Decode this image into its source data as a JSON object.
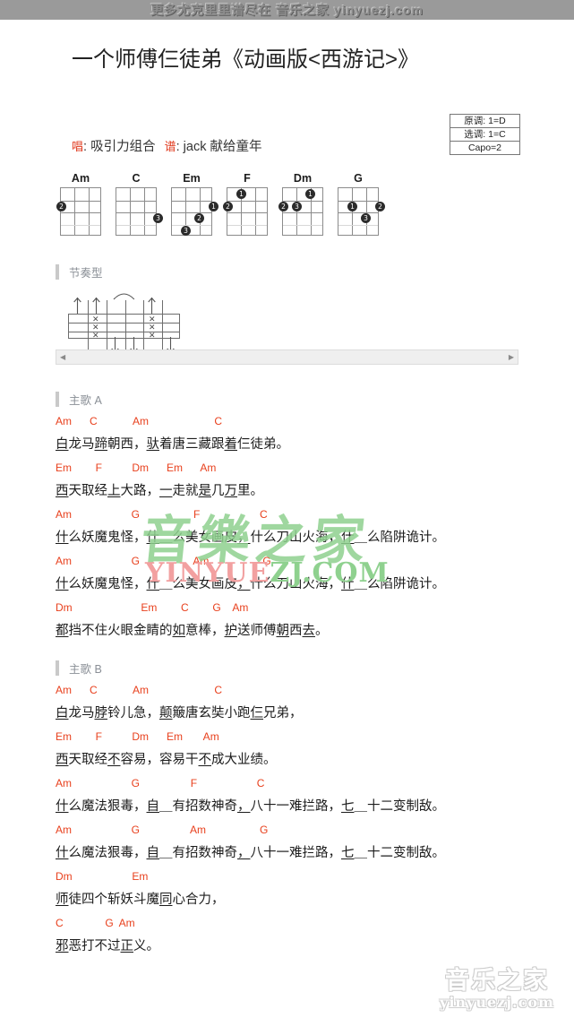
{
  "banner": {
    "text": "更多尤克里里谱尽在 音乐之家 yinyuezj.com"
  },
  "header": {
    "title": "一个师傅仨徒弟《动画版<西游记>》",
    "singer_label": "唱",
    "singer": "吸引力组合",
    "arranger_label": "谱",
    "arranger": "jack 献给童年"
  },
  "key_box": {
    "original_key": "原调: 1=D",
    "selected_key": "选调: 1=C",
    "capo": "Capo=2"
  },
  "chords": [
    {
      "name": "Am",
      "dots": [
        {
          "string": 1,
          "fret": 2,
          "finger": "2"
        }
      ]
    },
    {
      "name": "C",
      "dots": [
        {
          "string": 4,
          "fret": 3,
          "finger": "3"
        }
      ]
    },
    {
      "name": "Em",
      "dots": [
        {
          "string": 4,
          "fret": 2,
          "finger": "1"
        },
        {
          "string": 3,
          "fret": 3,
          "finger": "2"
        },
        {
          "string": 2,
          "fret": 4,
          "finger": "3"
        }
      ]
    },
    {
      "name": "F",
      "dots": [
        {
          "string": 2,
          "fret": 1,
          "finger": "1"
        },
        {
          "string": 1,
          "fret": 2,
          "finger": "2"
        }
      ]
    },
    {
      "name": "Dm",
      "dots": [
        {
          "string": 3,
          "fret": 1,
          "finger": "1"
        },
        {
          "string": 1,
          "fret": 2,
          "finger": "2"
        },
        {
          "string": 2,
          "fret": 2,
          "finger": "3"
        }
      ]
    },
    {
      "name": "G",
      "dots": [
        {
          "string": 2,
          "fret": 2,
          "finger": "1"
        },
        {
          "string": 4,
          "fret": 2,
          "finger": "2"
        },
        {
          "string": 3,
          "fret": 3,
          "finger": "3"
        }
      ]
    }
  ],
  "rhythm": {
    "title": "节奏型",
    "up_arrows": [
      1,
      2,
      5
    ],
    "down_arrows": [
      3,
      4,
      6
    ],
    "muted_columns": [
      2,
      5
    ],
    "tie_over": [
      3,
      4
    ],
    "brackets": [
      [
        2,
        3
      ],
      [
        5,
        6
      ]
    ]
  },
  "scrollbar": {
    "left_arrow": "◀",
    "right_arrow": "▶"
  },
  "sections": [
    {
      "title": "主歌 A",
      "lines": [
        {
          "chords": "Am      C            Am                      C",
          "lyric": "白龙马蹄朝西，驮着唐三藏跟着仨徒弟。"
        },
        {
          "chords": "Em        F          Dm      Em      Am",
          "lyric": "西天取经上大路，一走就是几万里。"
        },
        {
          "chords": "Am                    G                  F                    C",
          "lyric": "什么妖魔鬼怪，什＿么美女画皮，什么刀山火海，什＿么陷阱诡计。"
        },
        {
          "chords": "Am                    G                  Am                  G",
          "lyric": "什么妖魔鬼怪，什＿么美女画皮，什么刀山火海，什＿么陷阱诡计。"
        },
        {
          "chords": "Dm                       Em        C        G    Am",
          "lyric": "都挡不住火眼金睛的如意棒，护送师傅朝西去。"
        }
      ]
    },
    {
      "title": "主歌 B",
      "lines": [
        {
          "chords": "Am      C            Am                      C",
          "lyric": "白龙马脖铃儿急，颠簸唐玄奘小跑仨兄弟，"
        },
        {
          "chords": "Em        F          Dm      Em       Am",
          "lyric": "西天取经不容易，容易干不成大业绩。"
        },
        {
          "chords": "Am                    G                 F                    C",
          "lyric": "什么魔法狠毒，自＿有招数神奇，八十一难拦路，七＿十二变制敌。"
        },
        {
          "chords": "Am                    G                 Am                  G",
          "lyric": "什么魔法狠毒，自＿有招数神奇，八十一难拦路，七＿十二变制敌。"
        },
        {
          "chords": "Dm                    Em",
          "lyric": "师徒四个斩妖斗魔同心合力，"
        },
        {
          "chords": "C              G  Am",
          "lyric": "邪恶打不过正义。"
        }
      ]
    }
  ],
  "watermark_center": {
    "cn": "音樂之家",
    "en_pink": "YINYUE",
    "en_green": "ZJ.COM"
  },
  "watermark_bottom": {
    "cn": "音乐之家",
    "url": "yinyuezj.com"
  },
  "colors": {
    "chord_red": "#e8401d",
    "section_gray": "#8a8f96",
    "banner_gray": "#9a9a9a"
  }
}
